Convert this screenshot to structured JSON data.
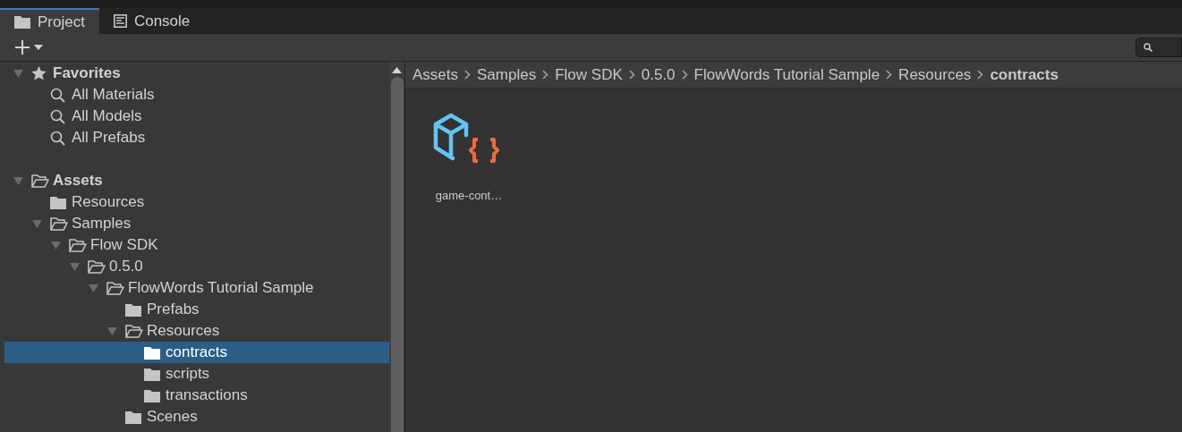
{
  "tabs": [
    {
      "label": "Project",
      "kind": "folder",
      "selected": true
    },
    {
      "label": "Console",
      "kind": "console",
      "selected": false
    }
  ],
  "tree": [
    {
      "label": "Favorites",
      "kind": "favorites",
      "expanded": true,
      "selected": false,
      "children": [
        {
          "label": "All Materials",
          "kind": "search",
          "selected": false
        },
        {
          "label": "All Models",
          "kind": "search",
          "selected": false
        },
        {
          "label": "All Prefabs",
          "kind": "search",
          "selected": false
        }
      ]
    },
    {
      "label": "Assets",
      "kind": "root",
      "expanded": true,
      "selected": false,
      "children": [
        {
          "label": "Resources",
          "kind": "folder",
          "selected": false
        },
        {
          "label": "Samples",
          "kind": "folder",
          "expanded": true,
          "selected": false,
          "children": [
            {
              "label": "Flow SDK",
              "kind": "folder",
              "expanded": true,
              "selected": false,
              "children": [
                {
                  "label": "0.5.0",
                  "kind": "folder",
                  "expanded": true,
                  "selected": false,
                  "children": [
                    {
                      "label": "FlowWords Tutorial Sample",
                      "kind": "folder",
                      "expanded": true,
                      "selected": false,
                      "children": [
                        {
                          "label": "Prefabs",
                          "kind": "folder",
                          "selected": false
                        },
                        {
                          "label": "Resources",
                          "kind": "folder",
                          "expanded": true,
                          "selected": false,
                          "children": [
                            {
                              "label": "contracts",
                              "kind": "folder",
                              "selected": true
                            },
                            {
                              "label": "scripts",
                              "kind": "folder",
                              "selected": false
                            },
                            {
                              "label": "transactions",
                              "kind": "folder",
                              "selected": false
                            }
                          ]
                        },
                        {
                          "label": "Scenes",
                          "kind": "folder",
                          "selected": false
                        }
                      ]
                    }
                  ]
                }
              ]
            }
          ]
        }
      ]
    }
  ],
  "breadcrumb": [
    {
      "label": "Assets",
      "current": false
    },
    {
      "label": "Samples",
      "current": false
    },
    {
      "label": "Flow SDK",
      "current": false
    },
    {
      "label": "0.5.0",
      "current": false
    },
    {
      "label": "FlowWords Tutorial Sample",
      "current": false
    },
    {
      "label": "Resources",
      "current": false
    },
    {
      "label": "contracts",
      "current": true
    }
  ],
  "assets": [
    {
      "name": "game-cont…",
      "kind": "contract"
    }
  ]
}
